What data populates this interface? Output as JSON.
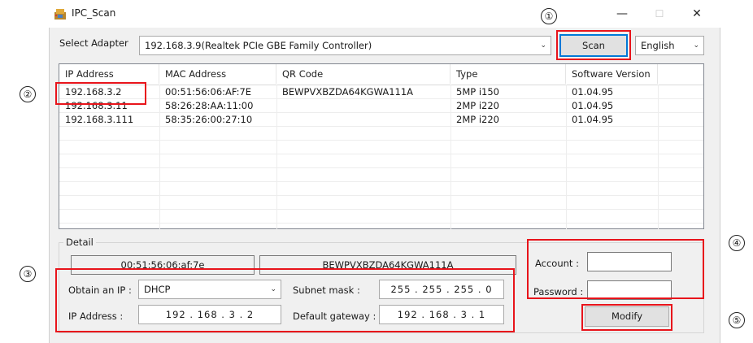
{
  "window": {
    "title": "IPC_Scan",
    "minimize_glyph": "—",
    "maximize_glyph": "☐",
    "close_glyph": "✕"
  },
  "adapter": {
    "label": "Select Adapter",
    "selected": "192.168.3.9(Realtek PCIe GBE Family Controller)",
    "scan_label": "Scan",
    "language": "English"
  },
  "table": {
    "columns": [
      "IP Address",
      "MAC Address",
      "QR Code",
      "Type",
      "Software Version"
    ],
    "rows": [
      [
        "192.168.3.2",
        "00:51:56:06:AF:7E",
        "BEWPVXBZDA64KGWA111A",
        "5MP i150",
        "01.04.95"
      ],
      [
        "192.168.3.11",
        "58:26:28:AA:11:00",
        "",
        "2MP i220",
        "01.04.95"
      ],
      [
        "192.168.3.111",
        "58:35:26:00:27:10",
        "",
        "2MP i220",
        "01.04.95"
      ]
    ]
  },
  "detail": {
    "title": "Detail",
    "mac": "00:51:56:06:af:7e",
    "qr": "BEWPVXBZDA64KGWA111A",
    "obtain_ip_label": "Obtain an IP :",
    "obtain_ip_value": "DHCP",
    "ip_address_label": "IP Address :",
    "ip_address": "192  .  168  .   3   .   2",
    "subnet_label": "Subnet mask :",
    "subnet": "255  .  255  .  255  .   0",
    "gateway_label": "Default gateway :",
    "gateway": "192  .  168  .   3   .   1",
    "account_label": "Account :",
    "account_value": "",
    "password_label": "Password :",
    "password_value": "",
    "modify_label": "Modify"
  },
  "annotations": [
    "①",
    "②",
    "③",
    "④",
    "⑤"
  ],
  "colors": {
    "highlight": "#e8141b",
    "focus": "#0078d7"
  }
}
